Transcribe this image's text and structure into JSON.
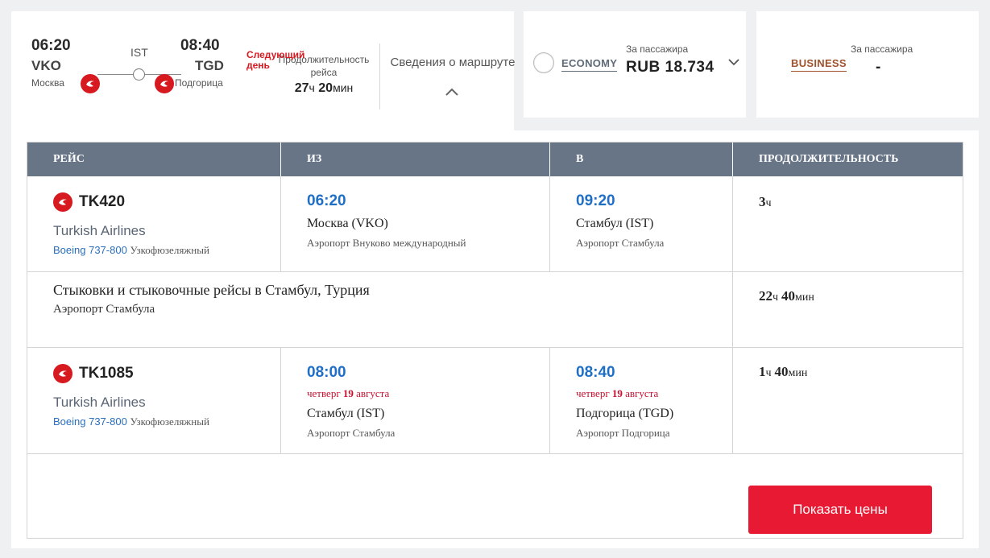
{
  "summary": {
    "depart_time": "06:20",
    "depart_code": "VKO",
    "depart_city": "Москва",
    "stop_code": "IST",
    "arrive_time": "08:40",
    "arrive_code": "TGD",
    "arrive_city": "Подгорица",
    "next_day": "Следующий день",
    "duration_label": "Продолжительность рейса",
    "duration_hours": "27",
    "hours_unit": "ч",
    "duration_minutes": "20",
    "minutes_unit": "мин",
    "route_details": "Сведения о маршруте"
  },
  "fares": {
    "economy": {
      "name": "ECONOMY",
      "per_passenger": "За пассажира",
      "price": "RUB 18.734"
    },
    "business": {
      "name": "BUSINESS",
      "per_passenger": "За пассажира",
      "price": "-"
    }
  },
  "table": {
    "headers": [
      "РЕЙС",
      "ИЗ",
      "В",
      "ПРОДОЛЖИТЕЛЬНОСТЬ"
    ],
    "segments": [
      {
        "flight": "TK420",
        "airline": "Turkish Airlines",
        "aircraft_model": "Boeing 737-800",
        "aircraft_type": "Узкофюзеляжный",
        "from_time": "06:20",
        "from_city": "Москва (VKO)",
        "from_airport": "Аэропорт Внуково международный",
        "to_time": "09:20",
        "to_city": "Стамбул (IST)",
        "to_airport": "Аэропорт Стамбула",
        "duration_h": "3",
        "duration_h_unit": "ч"
      },
      {
        "flight": "TK1085",
        "airline": "Turkish Airlines",
        "aircraft_model": "Boeing 737-800",
        "aircraft_type": "Узкофюзеляжный",
        "from_time": "08:00",
        "from_date_prefix": "четверг",
        "from_date_day": "19",
        "from_date_month": "августа",
        "from_city": "Стамбул (IST)",
        "from_airport": "Аэропорт Стамбула",
        "to_time": "08:40",
        "to_date_prefix": "четверг",
        "to_date_day": "19",
        "to_date_month": "августа",
        "to_city": "Подгорица (TGD)",
        "to_airport": "Аэропорт Подгорица",
        "duration_h": "1",
        "duration_h_unit": "ч",
        "duration_m": "40",
        "duration_m_unit": "мин"
      }
    ],
    "connection": {
      "title": "Стыковки и стыковочные рейсы в Стамбул, Турция",
      "airport": "Аэропорт Стамбула",
      "duration_h": "22",
      "duration_h_unit": "ч",
      "duration_m": "40",
      "duration_m_unit": "мин"
    }
  },
  "actions": {
    "show_prices": "Показать цены"
  },
  "colors": {
    "brand_red": "#e81932",
    "header_bg": "#677586",
    "time_blue": "#1f6fc7",
    "economy": "#5f6b78",
    "business": "#a0522d"
  },
  "icons": [
    "turkish-airlines-logo-icon",
    "chevron-up-icon",
    "chevron-down-icon",
    "radio-icon"
  ]
}
